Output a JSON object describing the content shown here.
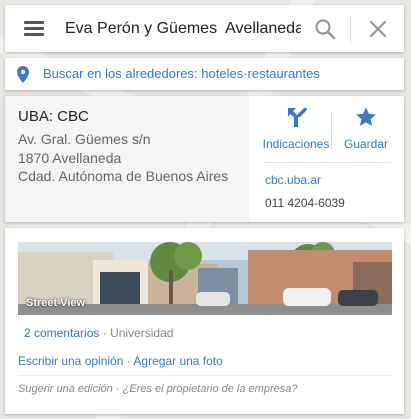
{
  "search": {
    "value": "Eva Perón y Güemes  Avellaneda",
    "placeholder": ""
  },
  "nearby": {
    "prefix": "Buscar en los alrededores:",
    "options": [
      "hoteles",
      "restaurantes"
    ],
    "separator": "·"
  },
  "place": {
    "name": "UBA: CBC",
    "address_lines": [
      "Av. Gral. Güemes s/n",
      "1870 Avellaneda",
      "Cdad. Autónoma de Buenos Aires"
    ],
    "actions": {
      "directions_label": "Indicaciones",
      "save_label": "Guardar"
    },
    "website": "cbc.uba.ar",
    "phone": "011 4204-6039"
  },
  "details": {
    "photo_label": "Street View",
    "reviews_link": "2 comentarios",
    "separator": "·",
    "category": "Universidad",
    "write_review": "Escribir una opinión",
    "add_photo": "Agregar una foto",
    "suggest_edit": "Sugerir una edición",
    "owner_question": "¿Eres el propietario de la empresa?"
  },
  "colors": {
    "accent": "#3a78c8",
    "icon_grey": "#999999"
  }
}
